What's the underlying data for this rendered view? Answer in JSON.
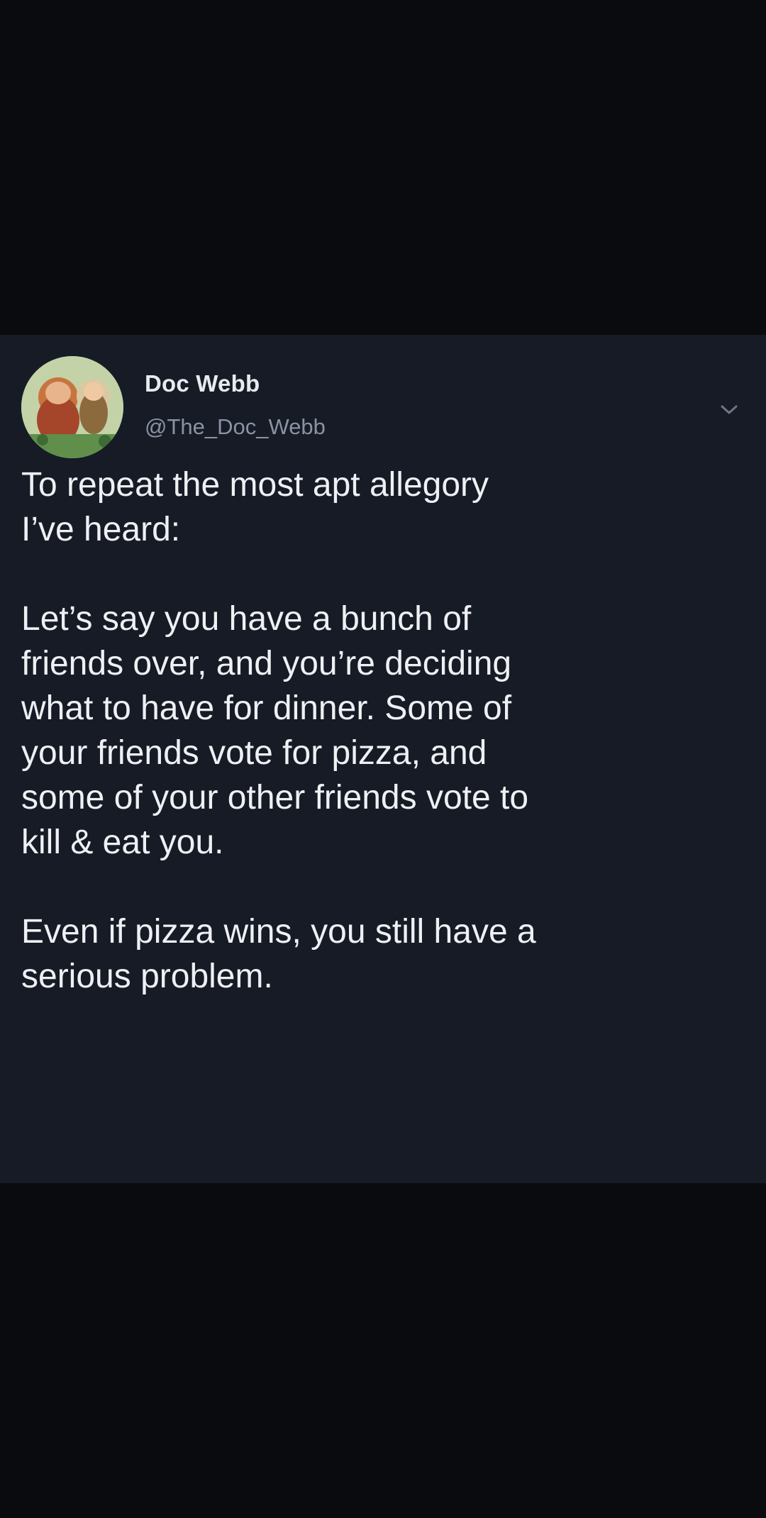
{
  "tweet": {
    "author": {
      "display_name": "Doc Webb",
      "handle": "@The_Doc_Webb",
      "avatar_icon": "avatar-illustration-icon"
    },
    "menu_icon": "chevron-down-icon",
    "paragraphs": [
      "To repeat the most apt allegory\nI’ve heard:",
      "Let’s say you have a bunch of\nfriends over, and you’re deciding\nwhat to have for dinner. Some of\nyour friends vote for pizza, and\nsome of your other friends vote to\nkill & eat you.",
      "Even if pizza wins, you still have a\nserious problem."
    ]
  },
  "colors": {
    "page_background": "#0a0b0e",
    "card_background": "#161b26",
    "primary_text": "#eef0f3",
    "secondary_text": "#8a93a3"
  }
}
